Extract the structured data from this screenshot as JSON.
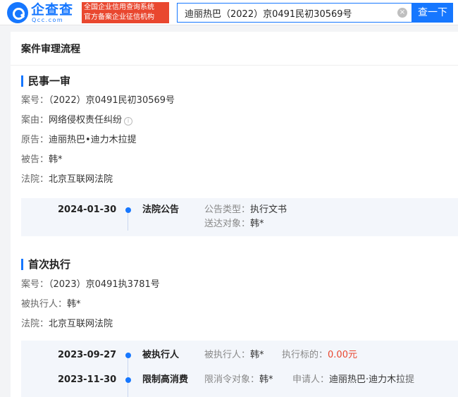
{
  "header": {
    "logo_name": "企查查",
    "logo_domain": "Qcc.com",
    "badge_line1": "全国企业信用查询系统",
    "badge_line2": "官方备案企业征信机构",
    "search_value": "迪丽热巴（2022）京0491民初30569号",
    "clear_icon": "×",
    "search_button": "查一下"
  },
  "page": {
    "section_title": "案件审理流程"
  },
  "first_instance": {
    "title": "民事一审",
    "case_no_label": "案号：",
    "case_no": "（2022）京0491民初30569号",
    "cause_label": "案由：",
    "cause": "网络侵权责任纠纷",
    "plaintiff_label": "原告：",
    "plaintiff": "迪丽热巴•迪力木拉提",
    "defendant_label": "被告：",
    "defendant": "韩*",
    "court_label": "法院：",
    "court": "北京互联网法院",
    "events": [
      {
        "date": "2024-01-30",
        "type": "法院公告",
        "k1": "公告类型：",
        "v1": "执行文书",
        "k2": "送达对象：",
        "v2": "韩*"
      }
    ]
  },
  "execution": {
    "title": "首次执行",
    "case_no_label": "案号：",
    "case_no": "（2023）京0491执3781号",
    "person_label": "被执行人：",
    "person": "韩*",
    "court_label": "法院：",
    "court": "北京互联网法院",
    "events": [
      {
        "date": "2023-09-27",
        "type": "被执行人",
        "k1": "被执行人：",
        "v1": "韩*",
        "k2": "执行标的：",
        "v2": "0.00元"
      },
      {
        "date": "2023-11-30",
        "type": "限制高消费",
        "k1": "限消令对象：",
        "v1": "韩*",
        "k2": "申请人：",
        "v2": "迪丽热巴·迪力木拉提"
      }
    ]
  },
  "colors": {
    "brand": "#1677ff",
    "badge": "#e9472f",
    "amount": "#e9472f"
  },
  "icons": {
    "logo": "search-logo-icon",
    "info": "info-circle-icon",
    "clear": "clear-circle-icon",
    "timeline_dot": "timeline-dot-icon"
  }
}
